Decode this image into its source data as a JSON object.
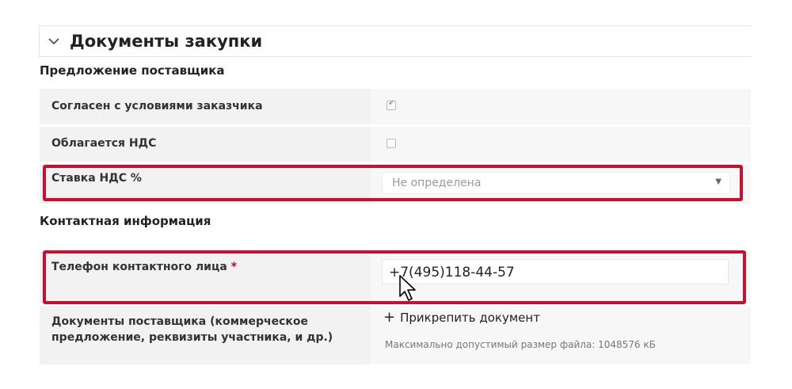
{
  "section": {
    "title": "Документы закупки",
    "toggle_icon": "chevron-down-icon"
  },
  "supplier_offer": {
    "heading": "Предложение поставщика",
    "rows": [
      {
        "label": "Согласен с условиями заказчика",
        "control": "checkbox",
        "checked": true
      },
      {
        "label": "Облагается НДС",
        "control": "checkbox",
        "checked": false
      },
      {
        "label": "Ставка НДС %",
        "control": "select",
        "value": "Не определена"
      }
    ]
  },
  "contact_info": {
    "heading": "Контактная информация",
    "phone": {
      "label": "Телефон контактного лица",
      "required_mark": "*",
      "value": "+7(495)118-44-57"
    },
    "documents": {
      "label_line1": "Документы поставщика (коммерческое",
      "label_line2": "предложение, реквизиты участника, и др.)",
      "attach_icon": "plus-icon",
      "attach_label": "Прикрепить документ",
      "hint": "Максимально допустимый размер файла: 1048576 кБ"
    }
  },
  "colors": {
    "highlight": "#c8102e",
    "required": "#d0021b",
    "row_background": "#f2f2f2"
  }
}
